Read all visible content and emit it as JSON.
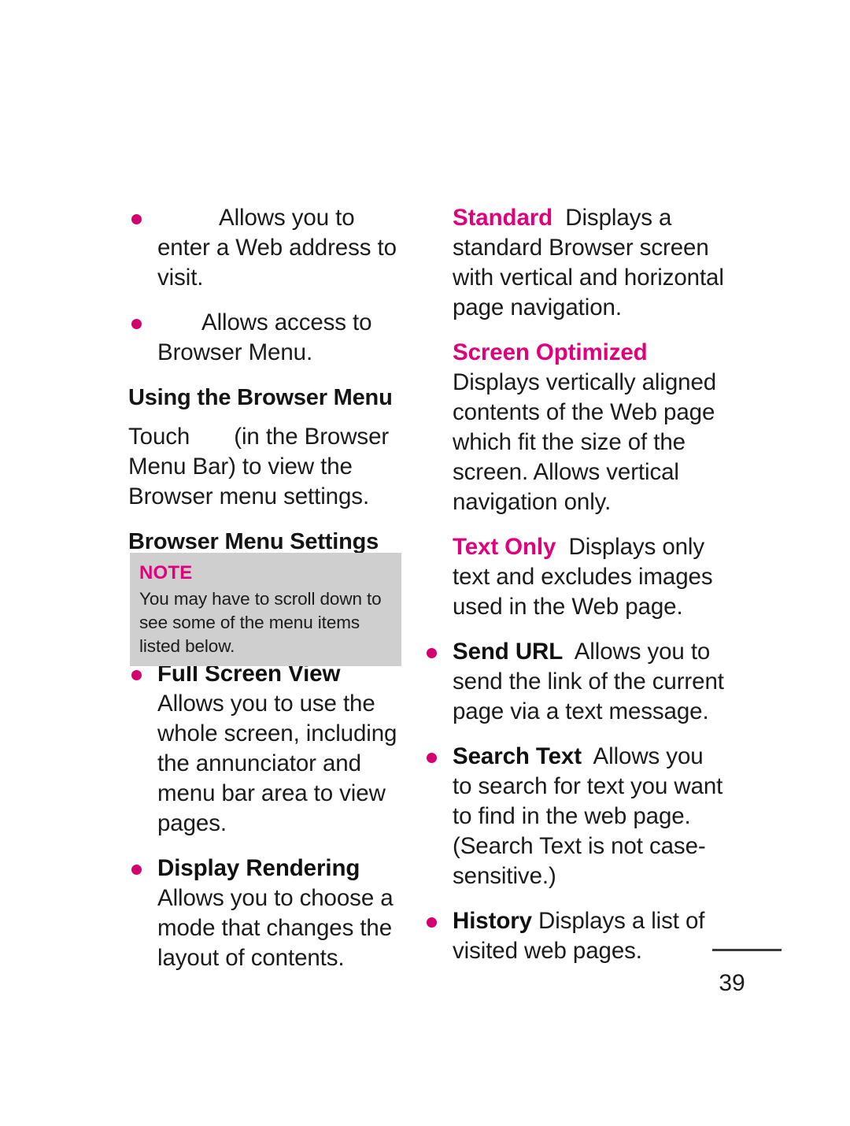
{
  "page": {
    "number": "39",
    "note_label": "NOTE",
    "note_body": "You may have to scroll down to see some of the menu items listed below."
  },
  "colors": {
    "accent_magenta": "#e0007c",
    "bullet_magenta": "#d4006f",
    "note_background": "#cfcfcf",
    "body_text": "#1b1b1b"
  },
  "left_column": {
    "bullets_top": [
      {
        "icon": "address-bar-icon",
        "text": "Allows you to enter a Web address to visit."
      },
      {
        "icon": "browser-menu-icon",
        "text": "Allows access to Browser Menu."
      }
    ],
    "heading_using_browser_menu": "Using the Browser Menu",
    "touch_paragraph": {
      "prefix": "Touch",
      "icon": "menu-bar-icon",
      "suffix": "(in the Browser Menu Bar) to view the Browser menu settings."
    },
    "heading_browser_menu_settings": "Browser Menu Settings",
    "bullets_bottom": [
      {
        "lead": "Full Screen View",
        "text": "Allows you to use the whole screen, including the annunciator and menu bar area to view pages."
      },
      {
        "lead": "Display Rendering",
        "text": "Allows you to choose a mode that changes the layout of contents."
      }
    ]
  },
  "right_column": {
    "sub_items": [
      {
        "lead": "Standard",
        "text": "Displays a standard Browser screen with vertical and horizontal page navigation."
      },
      {
        "lead": "Screen Optimized",
        "text": "Displays vertically aligned contents of the Web page which fit the size of the screen. Allows vertical navigation only."
      },
      {
        "lead": "Text Only",
        "text": "Displays only text and excludes images used in the Web page."
      }
    ],
    "bullets": [
      {
        "lead": "Send URL",
        "text": "Allows you to send the link of the current page via a text message."
      },
      {
        "lead": "Search Text",
        "text": "Allows  you to search for text you want to find in the web page. (Search Text is not case-sensitive.)"
      },
      {
        "lead": "History",
        "text": "Displays a list of visited web pages."
      }
    ]
  }
}
